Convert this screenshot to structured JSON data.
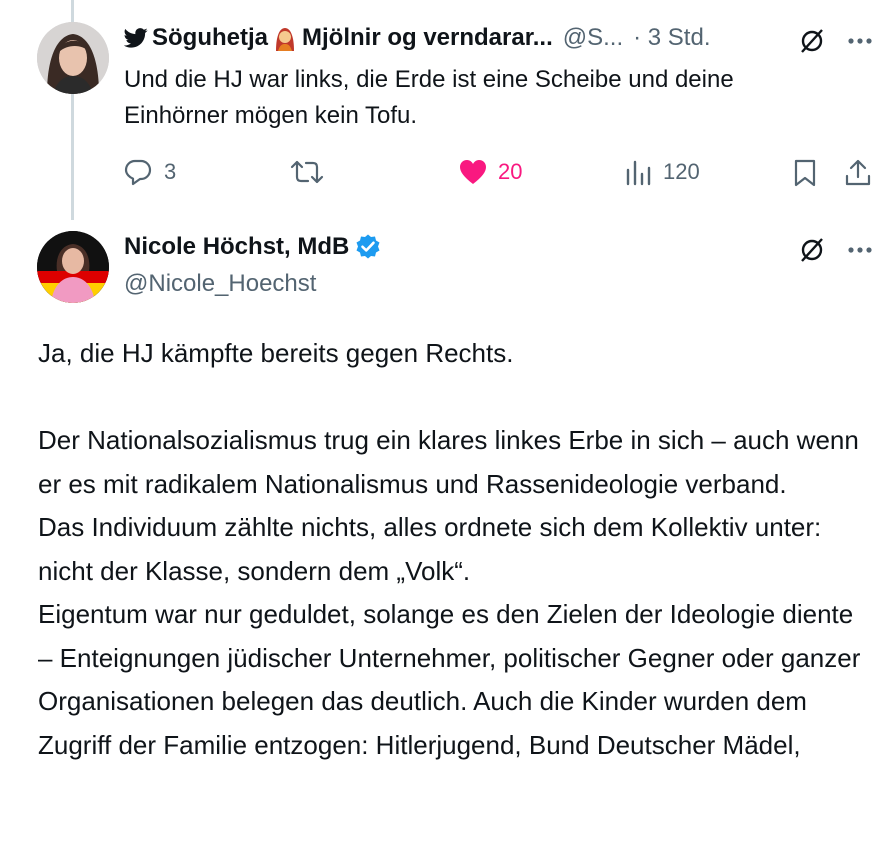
{
  "reply": {
    "author_name": "Söguhetja",
    "author_name_rest": "Mjölnir og verndarar...",
    "handle": "@S...",
    "time": "· 3 Std.",
    "text": "Und die HJ war links, die Erde ist eine Scheibe und deine Einhörner mögen kein Tofu.",
    "actions": {
      "replies": "3",
      "reposts": "",
      "likes": "20",
      "views": "120"
    },
    "icons": {
      "bird": "bird-icon",
      "emoji": "woman-emoji-icon",
      "grok": "grok-icon",
      "more": "more-icon"
    }
  },
  "post": {
    "author_name": "Nicole Höchst, MdB",
    "handle": "@Nicole_Hoechst",
    "verified": true,
    "paragraphs": [
      "Ja, die HJ kämpfte bereits gegen Rechts.",
      "Der Nationalsozialismus trug ein klares linkes Erbe in sich – auch wenn er es mit radikalem Nationalismus und Rassenideologie verband.",
      "Das Individuum zählte nichts, alles ordnete sich dem Kollektiv unter: nicht der Klasse, sondern dem „Volk“.",
      "Eigentum war nur geduldet, solange es den Zielen der Ideologie diente – Enteignungen jüdischer Unternehmer, politischer Gegner oder ganzer Organisationen belegen das deutlich. Auch die Kinder wurden dem Zugriff der Familie entzogen: Hitlerjugend, Bund Deutscher Mädel,"
    ]
  },
  "colors": {
    "like": "#f91880",
    "verified": "#1d9bf0",
    "muted": "#536471",
    "text": "#0f1419"
  }
}
